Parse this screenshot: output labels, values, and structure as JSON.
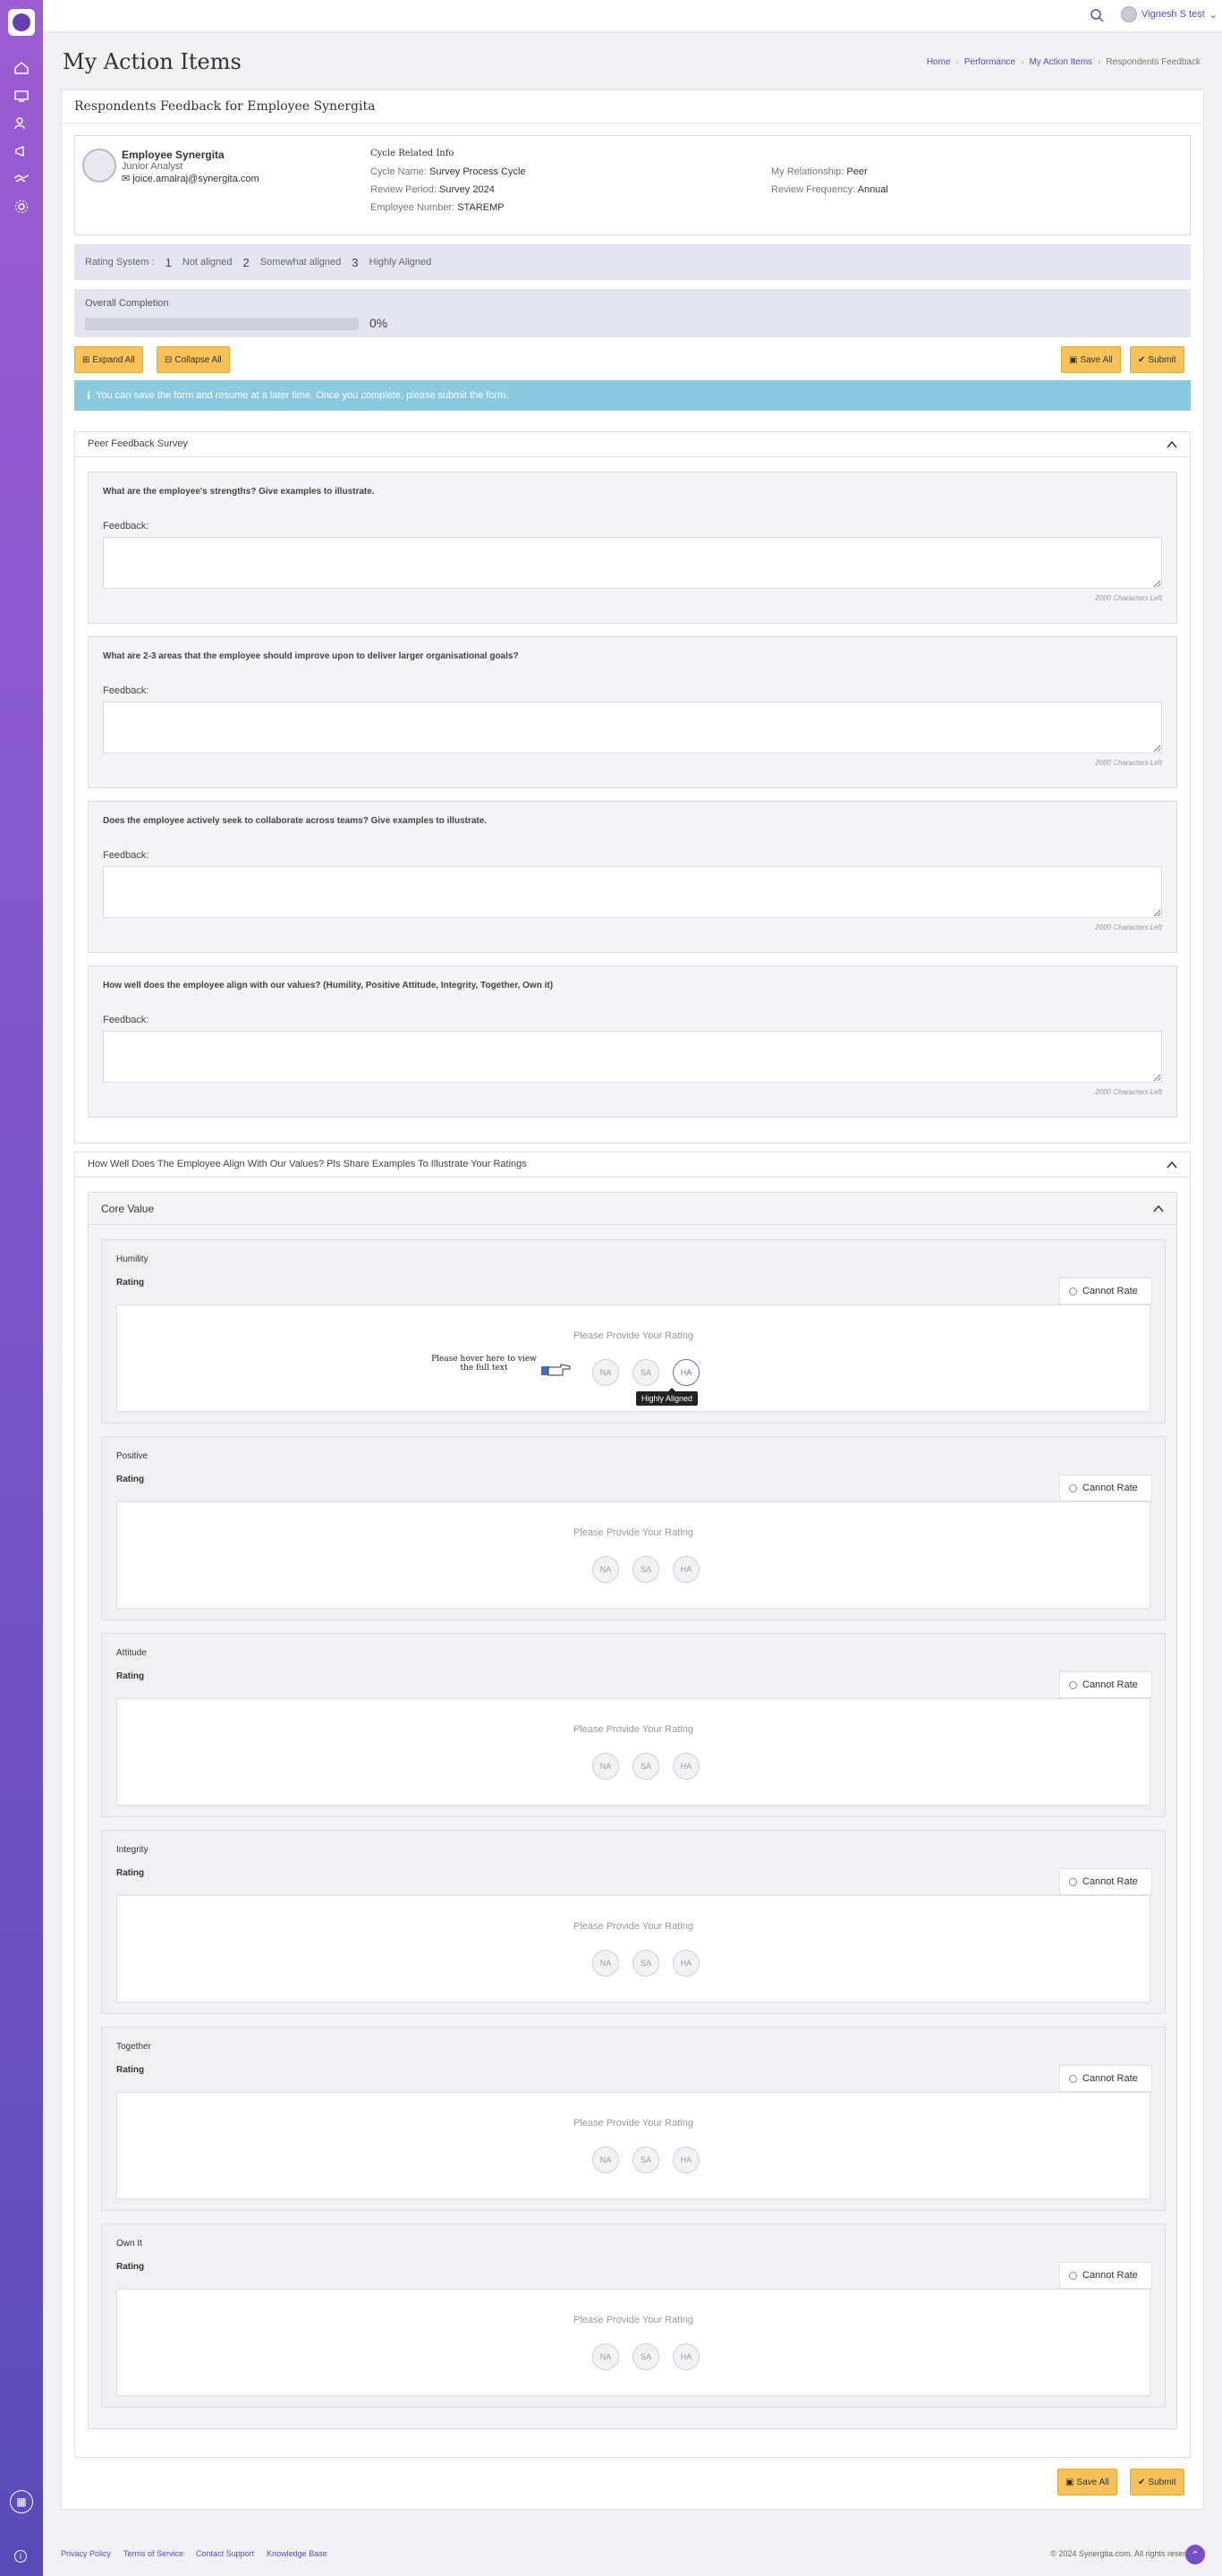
{
  "topbar": {
    "user_name": "Vignesh S test"
  },
  "page": {
    "title": "My Action Items"
  },
  "breadcrumb": [
    "Home",
    "Performance",
    "My Action Items",
    "Respondents Feedback"
  ],
  "card": {
    "title": "Respondents Feedback for Employee Synergita",
    "employee": {
      "name": "Employee Synergita",
      "role": "Junior Analyst",
      "email": "joice.amalraj@synergita.com"
    },
    "cycle": {
      "title": "Cycle Related Info",
      "cycle_name_label": "Cycle Name:",
      "cycle_name": "Survey Process Cycle",
      "review_period_label": "Review Period:",
      "review_period": "Survey 2024",
      "employee_number_label": "Employee Number:",
      "employee_number": "STAREMP",
      "relationship_label": "My Relationship:",
      "relationship": "Peer",
      "frequency_label": "Review Frequency:",
      "frequency": "Annual"
    }
  },
  "rating_system": {
    "label": "Rating System :",
    "items": [
      {
        "num": "1",
        "label": "Not aligned"
      },
      {
        "num": "2",
        "label": "Somewhat aligned"
      },
      {
        "num": "3",
        "label": "Highly Aligned"
      }
    ]
  },
  "completion": {
    "label": "Overall Completion",
    "percent_text": "0%",
    "progress": 0
  },
  "buttons": {
    "expand_all": "Expand All",
    "collapse_all": "Collapse All",
    "save_all": "Save All",
    "submit": "Submit"
  },
  "alert": "You can save the form and resume at a later time. Once you complete, please submit the form.",
  "peer_survey": {
    "title": "Peer Feedback Survey",
    "feedback_label": "Feedback:",
    "chars_left": "2000 Characters Left",
    "questions": [
      "What are the employee's strengths? Give examples to illustrate.",
      "What are 2-3 areas that the employee should improve upon to deliver larger organisational goals?",
      "Does the employee actively seek to collaborate across teams? Give examples to illustrate.",
      "How well does the employee align with our values? (Humility, Positive Attitude, Integrity, Together, Own it)"
    ]
  },
  "values_section": {
    "title": "How Well Does The Employee Align With Our Values? Pls Share Examples To Illustrate Your Ratings",
    "core_title": "Core Value",
    "rating_label": "Rating",
    "cannot_rate": "Cannot Rate",
    "prompt": "Please Provide Your Rating",
    "options": [
      "NA",
      "SA",
      "HA"
    ],
    "hover_note": "Please hover here to view the full text",
    "tooltip": "Highly Aligned",
    "values": [
      "Humility",
      "Positive",
      "Attitude",
      "Integrity",
      "Together",
      "Own It"
    ]
  },
  "footer": {
    "links": [
      "Privacy Policy",
      "Terms of Service",
      "Contact Support",
      "Knowledge Base"
    ],
    "copyright": "© 2024 Synergita.com. All rights reserved"
  }
}
